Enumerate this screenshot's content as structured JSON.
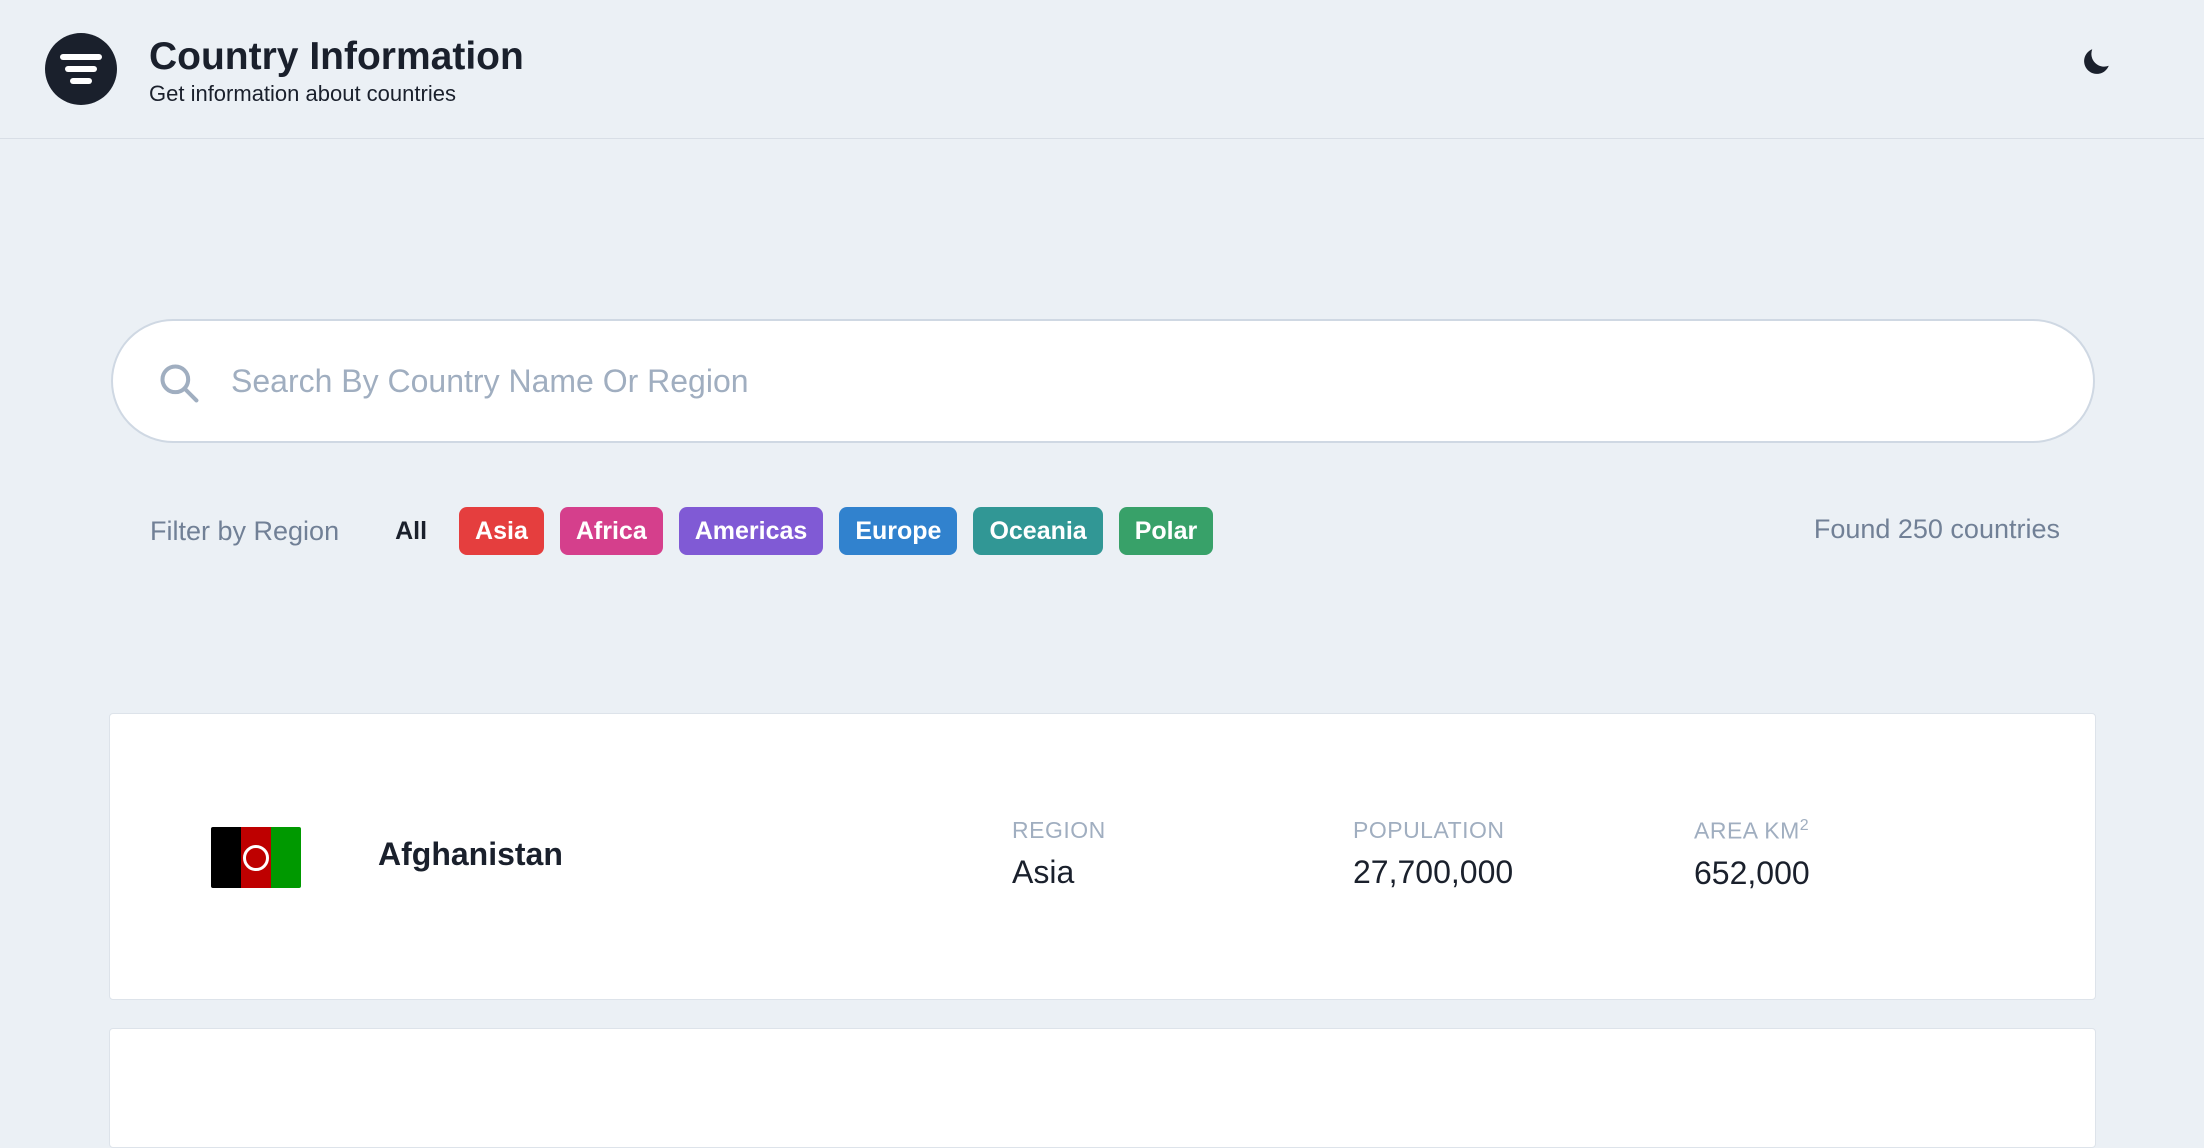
{
  "header": {
    "title": "Country Information",
    "subtitle": "Get information about countries",
    "logo_icon": "filter-icon",
    "theme_icon": "moon-icon"
  },
  "search": {
    "placeholder": "Search By Country Name Or Region",
    "value": ""
  },
  "filters": {
    "label": "Filter by Region",
    "options": [
      {
        "label": "All",
        "color": "transparent"
      },
      {
        "label": "Asia",
        "color": "#e53e3e"
      },
      {
        "label": "Africa",
        "color": "#d53f8c"
      },
      {
        "label": "Americas",
        "color": "#805ad5"
      },
      {
        "label": "Europe",
        "color": "#3182ce"
      },
      {
        "label": "Oceania",
        "color": "#319795"
      },
      {
        "label": "Polar",
        "color": "#38a169"
      }
    ],
    "found_text": "Found 250 countries"
  },
  "countries": [
    {
      "name": "Afghanistan",
      "flag_colors": [
        "#000000",
        "#be0000",
        "#009900"
      ],
      "region_label": "Region",
      "region": "Asia",
      "population_label": "Population",
      "population": "27,700,000",
      "area_label": "Area km",
      "area_sup": "2",
      "area": "652,000"
    }
  ]
}
